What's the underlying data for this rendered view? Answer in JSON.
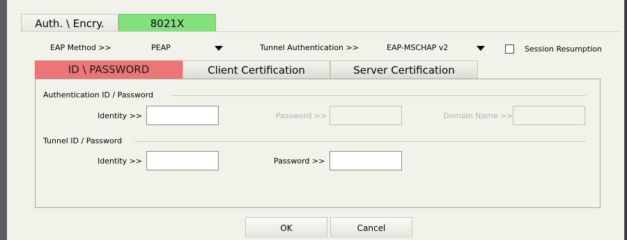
{
  "tabs": {
    "auth": "Auth. \\ Encry.",
    "x8021": "8021X"
  },
  "eap": {
    "method_label": "EAP Method >>",
    "method_value": "PEAP",
    "tunnel_label": "Tunnel Authentication >>",
    "tunnel_value": "EAP-MSCHAP v2",
    "session_label": "Session Resumption",
    "session_checked": false
  },
  "subtabs": {
    "id_password": "ID \\ PASSWORD",
    "client_cert": "Client Certification",
    "server_cert": "Server Certification"
  },
  "auth_group": {
    "title": "Authentication ID / Password",
    "identity_label": "Identity >>",
    "identity_value": "",
    "password_label": "Password >>",
    "password_value": "",
    "domain_label": "Domain Name >>",
    "domain_value": ""
  },
  "tunnel_group": {
    "title": "Tunnel ID / Password",
    "identity_label": "Identity >>",
    "identity_value": "",
    "password_label": "Password >>",
    "password_value": ""
  },
  "buttons": {
    "ok": "OK",
    "cancel": "Cancel"
  },
  "colors": {
    "active_tab": "#84e07c",
    "active_subtab": "#ec7575",
    "background": "#f2f1ea"
  }
}
